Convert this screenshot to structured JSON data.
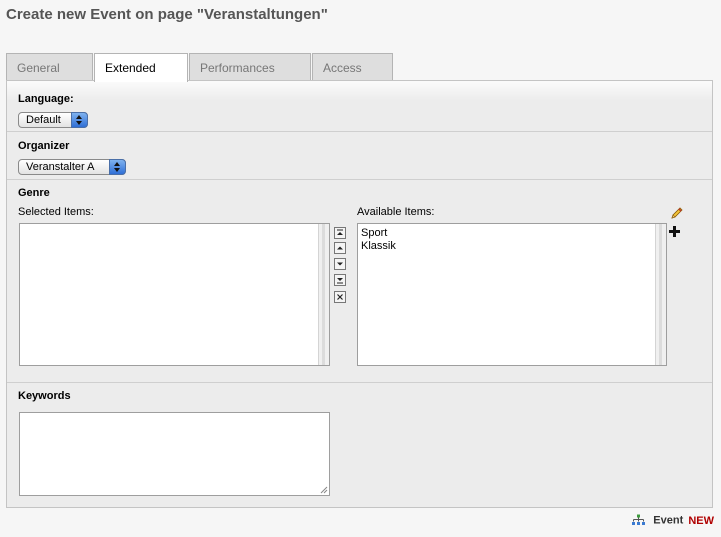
{
  "page": {
    "title": "Create new Event on page \"Veranstaltungen\""
  },
  "tabs": [
    {
      "label": "General"
    },
    {
      "label": "Extended"
    },
    {
      "label": "Performances"
    },
    {
      "label": "Access"
    }
  ],
  "language": {
    "label": "Language:",
    "value": "Default"
  },
  "organizer": {
    "label": "Organizer",
    "value": "Veranstalter A"
  },
  "genre": {
    "label": "Genre",
    "selected_label": "Selected Items:",
    "available_label": "Available Items:",
    "available_items": [
      "Sport",
      "Klassik"
    ],
    "controls": [
      "move-top",
      "move-up",
      "move-down",
      "move-bottom",
      "remove"
    ]
  },
  "keywords": {
    "label": "Keywords",
    "value": ""
  },
  "footer": {
    "record_type": "Event",
    "badge": "NEW",
    "badge_color": "#b00000"
  },
  "icons": {
    "edit": "pencil-icon",
    "add": "plus-icon",
    "record": "tree-icon"
  }
}
